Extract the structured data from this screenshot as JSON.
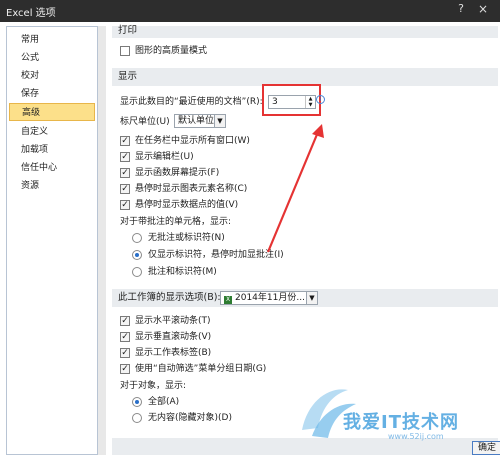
{
  "window": {
    "title": "Excel 选项",
    "help": "?",
    "close": "×"
  },
  "sidebar": {
    "items": [
      {
        "label": "常用",
        "active": false
      },
      {
        "label": "公式",
        "active": false
      },
      {
        "label": "校对",
        "active": false
      },
      {
        "label": "保存",
        "active": false
      },
      {
        "label": "高级",
        "active": true
      },
      {
        "label": "自定义",
        "active": false
      },
      {
        "label": "加载项",
        "active": false
      },
      {
        "label": "信任中心",
        "active": false
      },
      {
        "label": "资源",
        "active": false
      }
    ]
  },
  "print_section": {
    "header": "打印",
    "high_quality": {
      "label": "图形的高质量模式",
      "checked": false
    }
  },
  "display_section": {
    "header": "显示",
    "recent_docs_label": "显示此数目的“最近使用的文档”(R):",
    "recent_docs_value": "3",
    "ruler_label": "标尺单位(U)",
    "ruler_value": "默认单位",
    "checkboxes": [
      {
        "label": "在任务栏中显示所有窗口(W)",
        "checked": true
      },
      {
        "label": "显示编辑栏(U)",
        "checked": true
      },
      {
        "label": "显示函数屏幕提示(F)",
        "checked": true
      },
      {
        "label": "悬停时显示图表元素名称(C)",
        "checked": true
      },
      {
        "label": "悬停时显示数据点的值(V)",
        "checked": true
      }
    ],
    "comments_label": "对于带批注的单元格，显示:",
    "comment_options": [
      {
        "label": "无批注或标识符(N)",
        "selected": false
      },
      {
        "label": "仅显示标识符，悬停时加显批注(I)",
        "selected": true
      },
      {
        "label": "批注和标识符(M)",
        "selected": false
      }
    ]
  },
  "workbook_section": {
    "header_label": "此工作簿的显示选项(B):",
    "workbook_value": "2014年11月份...",
    "checkboxes": [
      {
        "label": "显示水平滚动条(T)",
        "checked": true
      },
      {
        "label": "显示垂直滚动条(V)",
        "checked": true
      },
      {
        "label": "显示工作表标签(B)",
        "checked": true
      },
      {
        "label": "使用“自动筛选”菜单分组日期(G)",
        "checked": true
      }
    ],
    "objects_label": "对于对象，显示:",
    "object_options": [
      {
        "label": "全部(A)",
        "selected": true
      },
      {
        "label": "无内容(隐藏对象)(D)",
        "selected": false
      }
    ]
  },
  "footer": {
    "ok": "确定"
  },
  "watermark": {
    "text": "我爱IT技术网",
    "url": "www.52ij.com"
  },
  "colors": {
    "highlight": "#fce08a",
    "annotation": "#e53333",
    "titlebar": "#2d2d2d"
  }
}
